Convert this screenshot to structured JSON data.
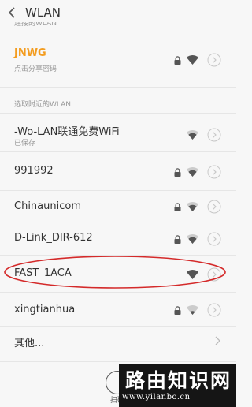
{
  "header": {
    "title": "WLAN",
    "cut_label": "连接的WLAN"
  },
  "connected": {
    "name": "JNWG",
    "sub": "点击分享密码",
    "accent": "#f39c1f"
  },
  "nearby_label": "选取附近的WLAN",
  "networks": [
    {
      "name": "-Wo-LAN联通免费WiFi",
      "sub": "已保存",
      "locked": false
    },
    {
      "name": "991992",
      "locked": true
    },
    {
      "name": "Chinaunicom",
      "locked": true
    },
    {
      "name": "D-Link_DIR-612",
      "locked": true
    },
    {
      "name": "FAST_1ACA",
      "locked": false,
      "highlighted": true
    },
    {
      "name": "xingtianhua",
      "locked": true
    }
  ],
  "other": {
    "label": "其他..."
  },
  "bottom": {
    "label": "扫码"
  },
  "watermark": {
    "title": "路由知识网",
    "url": "www.yilanbo.cn"
  },
  "colors": {
    "highlight": "#d42a2a",
    "icon": "#555555"
  }
}
